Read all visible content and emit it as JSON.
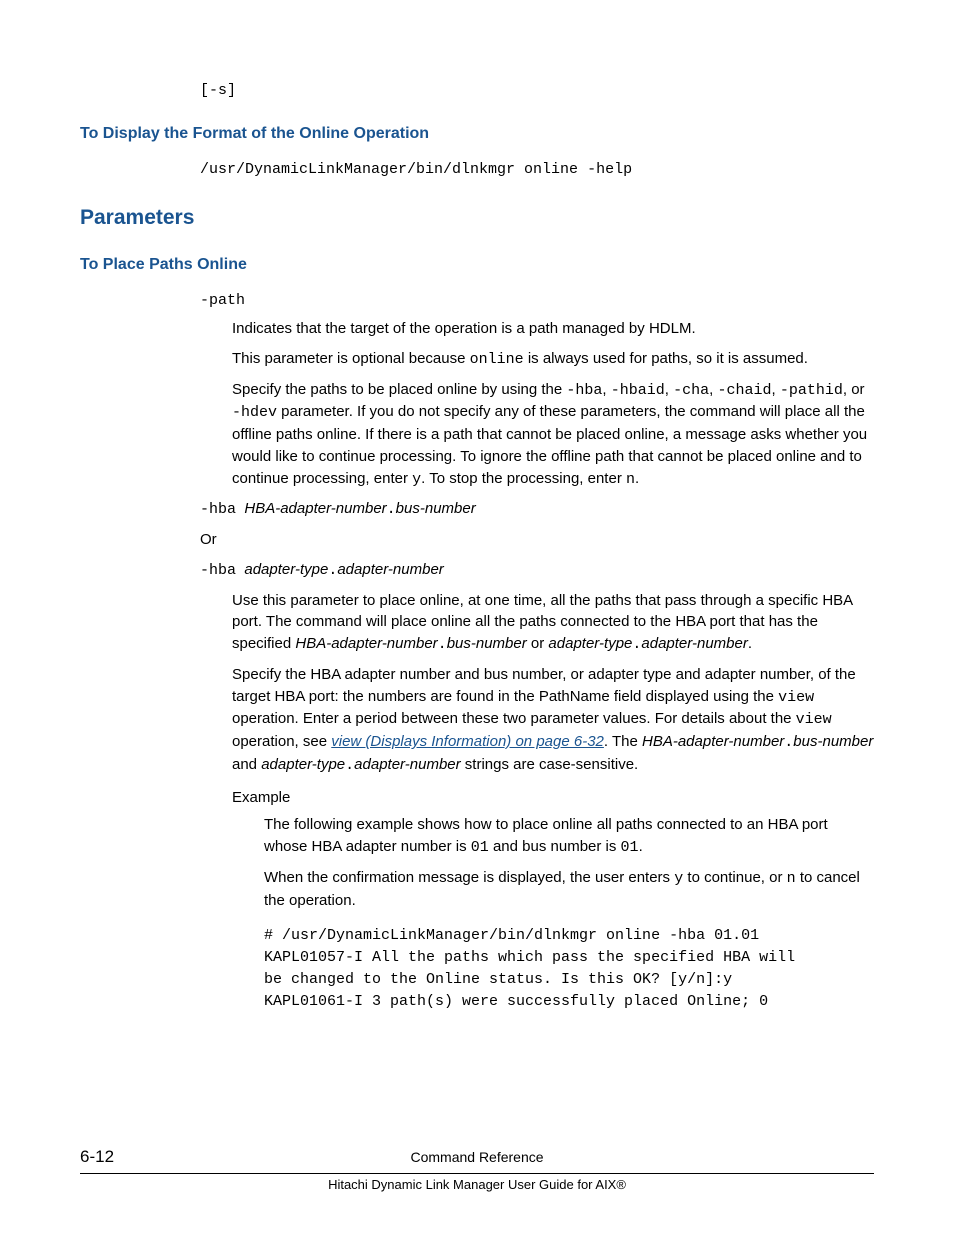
{
  "top_code": "[-s]",
  "h3_1": "To Display the Format of the Online Operation",
  "code_1": "/usr/DynamicLinkManager/bin/dlnkmgr online -help",
  "h2_1": "Parameters",
  "h3_2": "To Place Paths Online",
  "path": {
    "name": "-path",
    "d1": "Indicates that the target of the operation is a path managed by HDLM.",
    "d2_a": "This parameter is optional because ",
    "d2_code": "online",
    "d2_b": " is always used for paths, so it is assumed.",
    "d3_a": "Specify the paths to be placed online by using the ",
    "d3_c1": "-hba",
    "d3_s1": ", ",
    "d3_c2": "-hbaid",
    "d3_s2": ", ",
    "d3_c3": "-cha",
    "d3_s3": ", ",
    "d3_c4": "-chaid",
    "d3_s4": ", ",
    "d3_c5": "-pathid",
    "d3_s5": ", or ",
    "d3_c6": "-hdev",
    "d3_b": " parameter. If you do not specify any of these parameters, the command will place all the offline paths online. If there is a path that cannot be placed online, a message asks whether you would like to continue processing. To ignore the offline path that cannot be placed online and to continue processing, enter ",
    "d3_cy": "y",
    "d3_c": ". To stop the processing, enter ",
    "d3_cn": "n",
    "d3_d": "."
  },
  "hba1": {
    "pre": "-hba",
    "i1": "HBA-adapter-number",
    "dot": ".",
    "i2": "bus-number"
  },
  "or": "Or",
  "hba2": {
    "pre": "-hba",
    "i1": "adapter-type",
    "dot": ".",
    "i2": "adapter-number",
    "d1_a": "Use this parameter to place online, at one time, all the paths that pass through a specific HBA port. The command will place online all the paths connected to the HBA port that has the specified ",
    "d1_i1": "HBA-adapter-number",
    "d1_dot1": ".",
    "d1_i2": "bus-number",
    "d1_or": " or ",
    "d1_i3": "adapter-type",
    "d1_dot2": ".",
    "d1_i4": "adapter-number",
    "d1_end": ".",
    "d2_a": "Specify the HBA adapter number and bus number, or adapter type and adapter number, of the target HBA port: the numbers are found in the PathName field displayed using the ",
    "d2_c1": "view",
    "d2_b": " operation. Enter a period between these two parameter values. For details about the ",
    "d2_c2": "view",
    "d2_c": " operation, see ",
    "d2_link": "view (Displays Information) on page 6-32",
    "d2_d": ". The ",
    "d2_i1": "HBA-adapter-number",
    "d2_dot1": ".",
    "d2_i2": "bus-number",
    "d2_and": " and ",
    "d2_i3": "adapter-type",
    "d2_dot2": ".",
    "d2_i4": "adapter-number",
    "d2_e": " strings are case-sensitive."
  },
  "example": {
    "label": "Example",
    "d1_a": "The following example shows how to place online all paths connected to an HBA port whose HBA adapter number is ",
    "d1_c1": "01",
    "d1_b": " and bus number is ",
    "d1_c2": "01",
    "d1_c": ".",
    "d2_a": "When the confirmation message is displayed, the user enters ",
    "d2_cy": "y",
    "d2_b": " to continue, or ",
    "d2_cn": "n",
    "d2_c": " to cancel the operation.",
    "code_l1": "# /usr/DynamicLinkManager/bin/dlnkmgr online -hba 01.01",
    "code_l2": "KAPL01057-I All the paths which pass the specified HBA will",
    "code_l3": "be changed to the Online status. Is this OK? [y/n]:y",
    "code_l4": "KAPL01061-I 3 path(s) were successfully placed Online; 0"
  },
  "footer": {
    "page": "6-12",
    "title": "Command Reference",
    "subtitle": "Hitachi Dynamic Link Manager User Guide for AIX®"
  }
}
